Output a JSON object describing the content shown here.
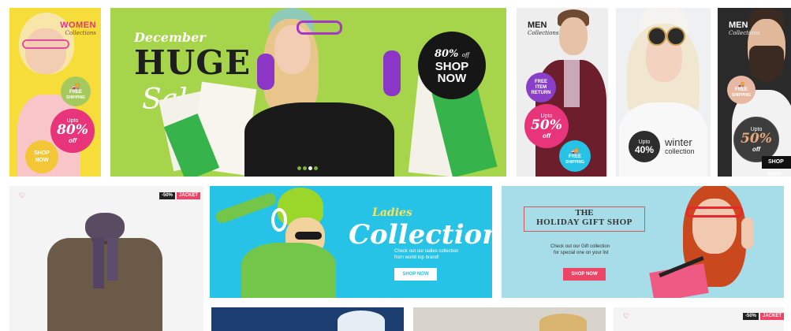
{
  "banner_women": {
    "title": "WOMEN",
    "subtitle": "Collections",
    "free_label": "FREE",
    "free_sub": "SHIPPING",
    "upto": "Upto",
    "percent": "80%",
    "off": "off",
    "shop_now": "SHOP NOW"
  },
  "hero": {
    "month": "December",
    "huge": "HUGE",
    "sale": "Sale",
    "badge_percent": "80%",
    "badge_off": "off",
    "badge_shop": "SHOP",
    "badge_now": "NOW",
    "active_slide": 3,
    "slide_count": 4
  },
  "banner_men1": {
    "title": "MEN",
    "subtitle": "Collections",
    "free_item": "FREE",
    "free_item2": "ITEM",
    "return": "RETURN",
    "upto": "Upto",
    "percent": "50%",
    "off": "off",
    "free_ship": "FREE",
    "free_ship2": "SHIPPING"
  },
  "banner_winter": {
    "upto": "Upto",
    "percent": "40%",
    "title": "winter",
    "subtitle": "collection"
  },
  "banner_men2": {
    "title": "MEN",
    "subtitle": "Collections",
    "free_label": "FREE",
    "free_sub": "SHIPPING",
    "upto": "Upto",
    "percent": "50%",
    "off": "off",
    "shop_now": "SHOP NOW"
  },
  "product_card": {
    "discount_tag": "-50%",
    "type_tag": "JACKET"
  },
  "ladies": {
    "title": "Ladies",
    "subtitle": "Collection",
    "desc1": "Check out our ladies collection",
    "desc2": "from world top brand!",
    "button": "SHOP NOW"
  },
  "gift": {
    "the": "THE",
    "title": "HOLIDAY GIFT SHOP",
    "desc1": "Check out our Gift collection",
    "desc2": "for special one on your list",
    "button": "SHOP NOW"
  },
  "bottom_card": {
    "discount_tag": "-50%",
    "type_tag": "JACKET"
  },
  "colors": {
    "accent_pink": "#e8347a",
    "lime": "#a6d44a",
    "cyan": "#27c3e6",
    "yellow": "#f7d42f",
    "red_button": "#ee4466"
  }
}
